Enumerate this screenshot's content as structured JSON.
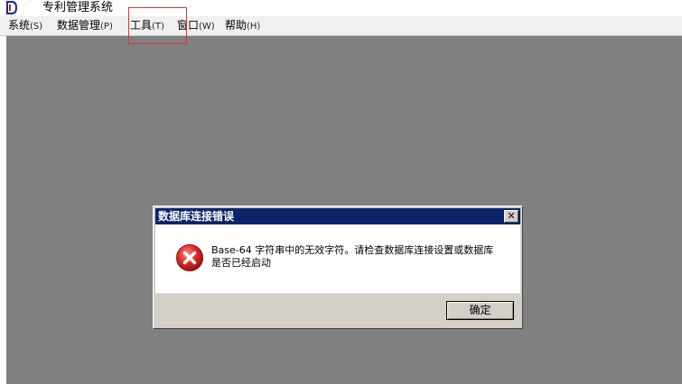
{
  "app": {
    "title": "专利管理系统"
  },
  "menu": {
    "items": [
      {
        "label": "系统",
        "accel": "(S)"
      },
      {
        "label": "数据管理",
        "accel": "(P)"
      },
      {
        "label": "工具",
        "accel": "(T)"
      },
      {
        "label": "窗口",
        "accel": "(W)"
      },
      {
        "label": "帮助",
        "accel": "(H)"
      }
    ]
  },
  "dialog": {
    "title": "数据库连接错误",
    "message": "Base-64 字符串中的无效字符。请检查数据库连接设置或数据库是否已经启动",
    "ok_label": "确定",
    "close_glyph": "✕",
    "icon": "error-icon"
  },
  "colors": {
    "client_background": "#808080",
    "dialog_title_background": "#0a246a",
    "error_red": "#d42020",
    "highlight_box": "#e03030"
  }
}
